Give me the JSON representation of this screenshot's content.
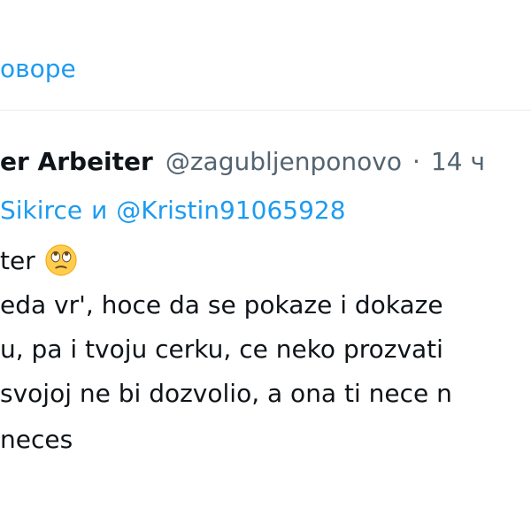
{
  "replies_link": "овоpe",
  "tweet": {
    "author_name": "er Arbeiter",
    "author_handle": "@zagubljenponovo",
    "separator": "·",
    "timestamp": "14 ч",
    "reply_to": {
      "mention_1": "Sikirce",
      "conjunction": "и",
      "mention_2": "@Kristin91065928"
    },
    "body_lines": [
      "ter",
      "eda vr', hoce da se pokaze i dokaze",
      "u, pa i tvoju cerku, ce neko prozvati",
      "svojoj ne bi dozvolio, a ona ti nece n",
      "neces"
    ],
    "emoji": "face-with-rolling-eyes"
  },
  "colors": {
    "link": "#1d9bf0",
    "text": "#0f1419",
    "secondary": "#536471",
    "divider": "#e6ecf0",
    "emoji_face": "#ffcc4d"
  }
}
